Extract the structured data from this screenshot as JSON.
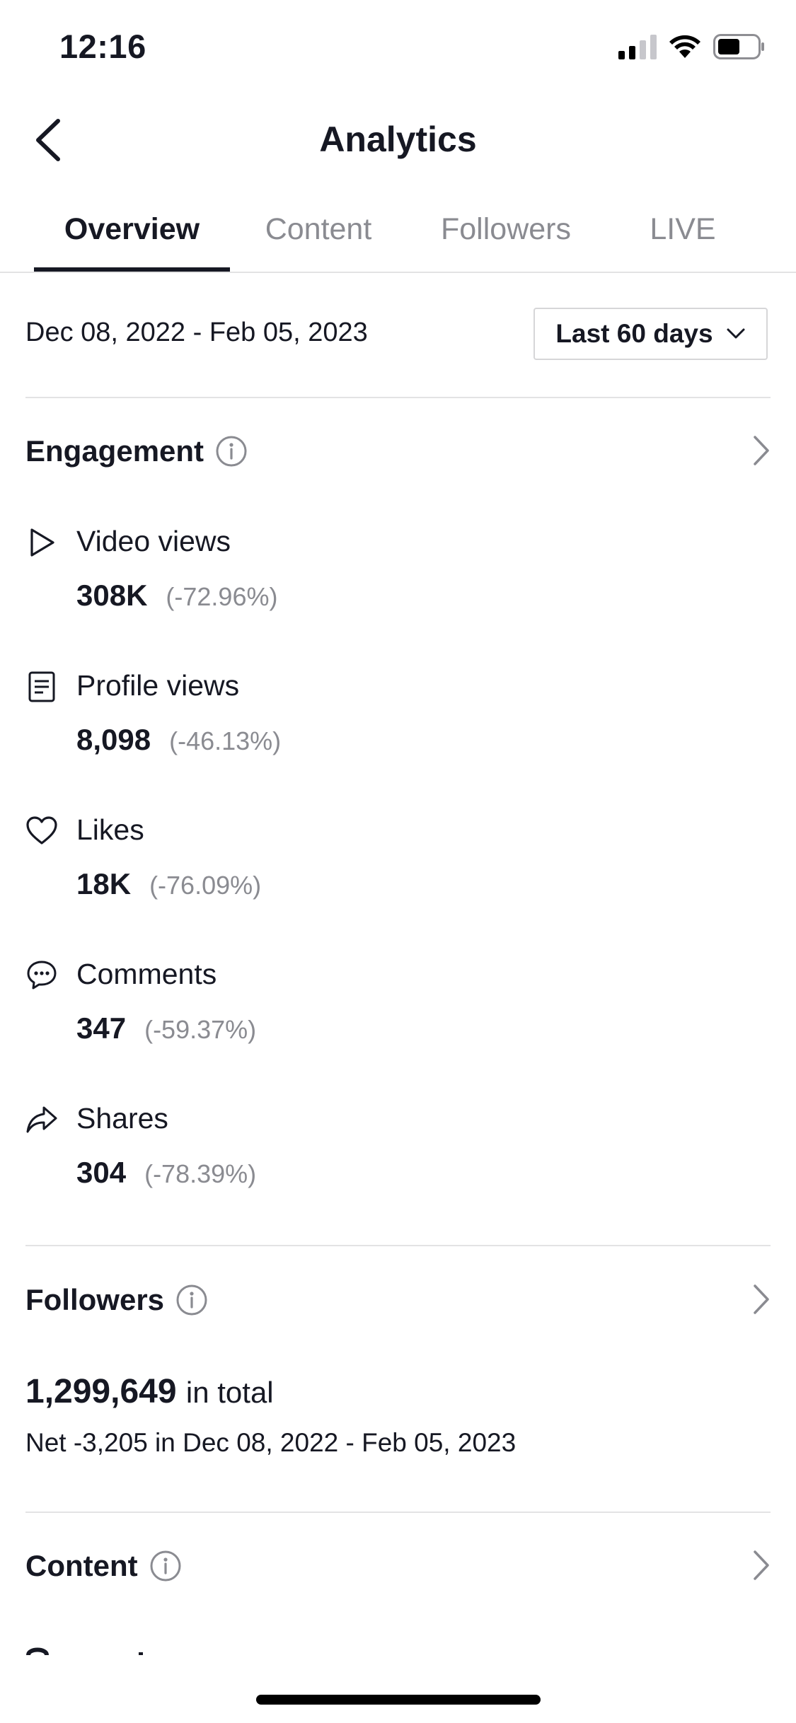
{
  "status_bar": {
    "time": "12:16",
    "icons": [
      "cellular-signal-icon",
      "wifi-icon",
      "battery-icon"
    ]
  },
  "nav": {
    "title": "Analytics",
    "back_icon": "chevron-left-icon"
  },
  "tabs": [
    {
      "label": "Overview",
      "active": true
    },
    {
      "label": "Content",
      "active": false
    },
    {
      "label": "Followers",
      "active": false
    },
    {
      "label": "LIVE",
      "active": false
    }
  ],
  "date_range": "Dec 08, 2022 - Feb 05, 2023",
  "range_selector": {
    "label": "Last 60 days",
    "icon": "chevron-down-icon"
  },
  "engagement": {
    "title": "Engagement",
    "info_icon": "info-icon",
    "metrics": [
      {
        "icon": "play-icon",
        "label": "Video views",
        "value": "308K",
        "change": "(-72.96%)"
      },
      {
        "icon": "profile-doc-icon",
        "label": "Profile views",
        "value": "8,098",
        "change": "(-46.13%)"
      },
      {
        "icon": "heart-icon",
        "label": "Likes",
        "value": "18K",
        "change": "(-76.09%)"
      },
      {
        "icon": "comment-icon",
        "label": "Comments",
        "value": "347",
        "change": "(-59.37%)"
      },
      {
        "icon": "share-icon",
        "label": "Shares",
        "value": "304",
        "change": "(-78.39%)"
      }
    ]
  },
  "followers": {
    "title": "Followers",
    "total": "1,299,649",
    "total_suffix": "in total",
    "net": "Net -3,205 in Dec 08, 2022 - Feb 05, 2023"
  },
  "content": {
    "title": "Content"
  },
  "colors": {
    "text_primary": "#161823",
    "text_secondary": "#8a8b91",
    "divider": "#e3e3e4"
  }
}
